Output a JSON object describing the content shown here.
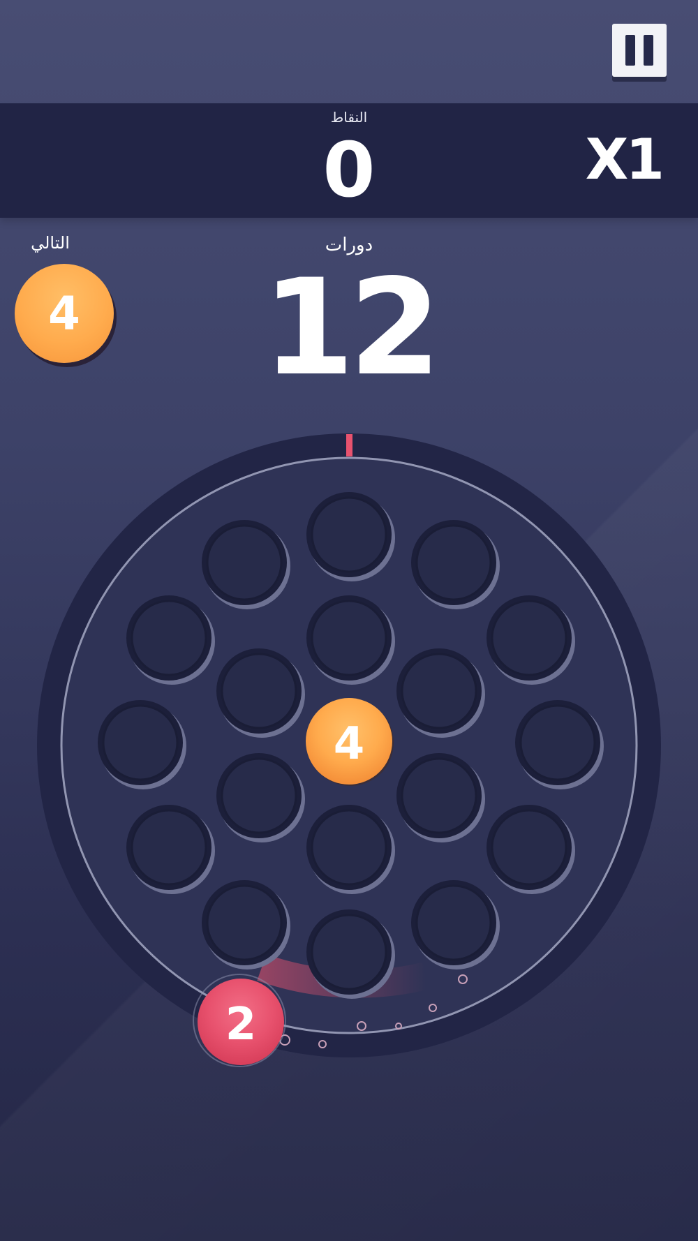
{
  "hud": {
    "score_label": "النقاط",
    "score_value": "0",
    "multiplier": "X1",
    "rounds_label": "دورات",
    "rounds_value": "12",
    "next_label": "التالي",
    "next_ball": "4"
  },
  "board": {
    "center_ball": "4",
    "launch_ball": "2",
    "slot_count": 19
  },
  "colors": {
    "orange_ball": "#ffab4d",
    "red_ball": "#e8526e",
    "marker": "#e8526e",
    "score_band": "#212445"
  },
  "icons": {
    "pause": "pause-icon"
  }
}
